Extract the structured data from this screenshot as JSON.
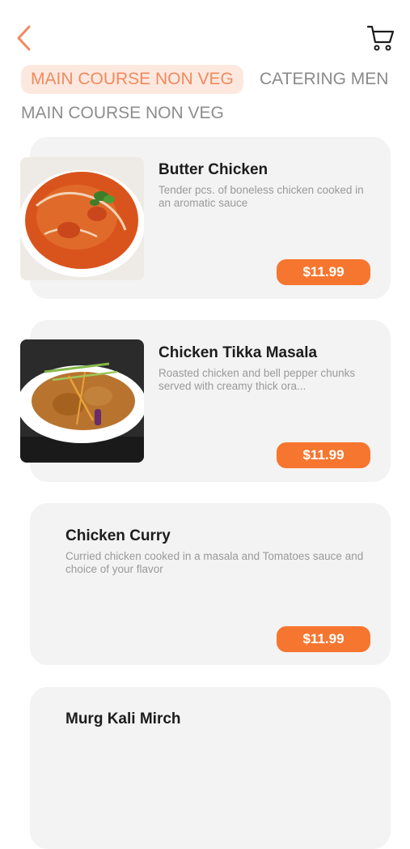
{
  "header": {
    "back_icon": "chevron-left-icon",
    "cart_icon": "shopping-cart-icon",
    "accent_color": "#f08a5d"
  },
  "tabs": [
    {
      "label": "MAIN COURSE NON VEG",
      "active": true
    },
    {
      "label": "CATERING MEN",
      "active": false
    }
  ],
  "section": {
    "title": "MAIN COURSE NON VEG"
  },
  "items": [
    {
      "name": "Butter Chicken",
      "description": "Tender pcs. of boneless chicken cooked in an aromatic sauce",
      "price": "$11.99",
      "has_image": true
    },
    {
      "name": "Chicken Tikka Masala",
      "description": "Roasted chicken and bell pepper chunks served with creamy thick ora...",
      "price": "$11.99",
      "has_image": true
    },
    {
      "name": "Chicken Curry",
      "description": "Curried chicken cooked in a masala and Tomatoes sauce and choice of your flavor",
      "price": "$11.99",
      "has_image": false
    },
    {
      "name": "Murg Kali Mirch",
      "description": "",
      "price": "",
      "has_image": false
    }
  ],
  "colors": {
    "price_button": "#f7762f",
    "card_background": "#f3f3f3",
    "active_tab_background": "#fde8df"
  }
}
